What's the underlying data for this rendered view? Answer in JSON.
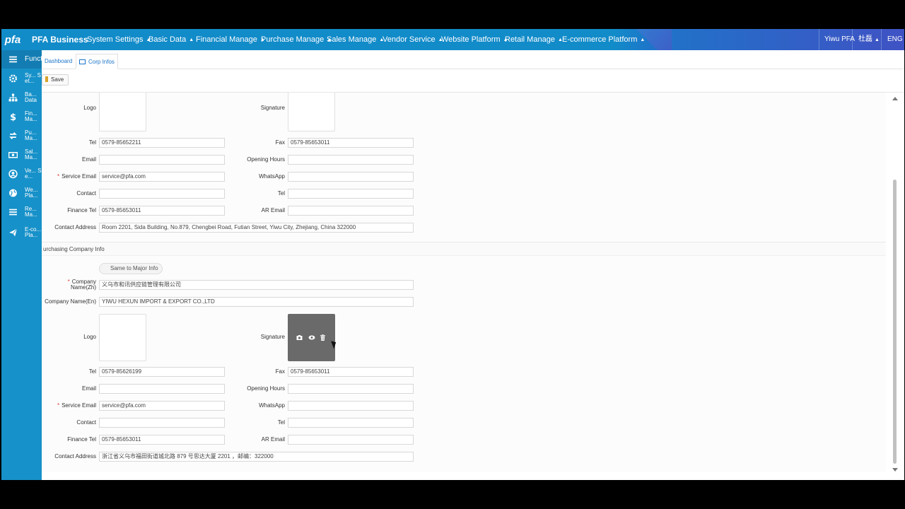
{
  "topbar": {
    "logo": "pfa",
    "brand": "PFA Business",
    "nav": [
      "System Settings",
      "Basic Data",
      "Financial Manage",
      "Purchase Manage",
      "Sales Manage",
      "Vendor Service",
      "Website Platform",
      "Retail Manage",
      "E-commerce Platform"
    ],
    "user": "Yiwu PFA",
    "lang_cn": "杜磊",
    "lang": "ENG"
  },
  "sidebar": {
    "header": "Functi",
    "items": [
      {
        "label": "Sy... Set...",
        "icon": "gear-icon"
      },
      {
        "label": "Ba... Data",
        "icon": "sitemap-icon"
      },
      {
        "label": "Fin... Ma...",
        "icon": "dollar-icon"
      },
      {
        "label": "Pu... Ma...",
        "icon": "exchange-icon"
      },
      {
        "label": "Sal... Ma...",
        "icon": "money-icon"
      },
      {
        "label": "Ve... Se...",
        "icon": "user-circle-icon"
      },
      {
        "label": "We... Pla...",
        "icon": "globe-icon"
      },
      {
        "label": "Re... Ma...",
        "icon": "list-icon"
      },
      {
        "label": "E-co... Pla...",
        "icon": "send-icon"
      }
    ]
  },
  "tabs": {
    "dashboard": "Dashboard",
    "corp": "Corp Infos"
  },
  "toolbar": {
    "save": "Save"
  },
  "major": {
    "logo": "Logo",
    "signature": "Signature",
    "tel_label": "Tel",
    "tel": "0579-85652211",
    "fax_label": "Fax",
    "fax": "0579-85653011",
    "email_label": "Email",
    "email": "",
    "hours_label": "Opening Hours",
    "hours": "",
    "service_email_label": "Service Email",
    "service_email": "service@pfa.com",
    "whatsapp_label": "WhatsApp",
    "whatsapp": "",
    "contact_label": "Contact",
    "contact": "",
    "tel2_label": "Tel",
    "tel2": "",
    "finance_tel_label": "Finance Tel",
    "finance_tel": "0579-85653011",
    "ar_email_label": "AR Email",
    "ar_email": "",
    "address_label": "Contact Address",
    "address": "Room 2201, Sida Building, No.879, Chengbei Road, Futian Street, Yiwu City, Zhejiang, China 322000"
  },
  "purchasing": {
    "section_title": "urchasing Company Info",
    "same_btn": "Same to Major Info",
    "name_zh_label": "Company Name(Zh)",
    "name_zh": "义乌市和讯供应链管理有限公司",
    "name_en_label": "Company Name(En)",
    "name_en": "YIWU HEXUN IMPORT & EXPORT CO.,LTD",
    "logo": "Logo",
    "signature": "Signature",
    "tel_label": "Tel",
    "tel": "0579-85626199",
    "fax_label": "Fax",
    "fax": "0579-85653011",
    "email_label": "Email",
    "email": "",
    "hours_label": "Opening Hours",
    "hours": "",
    "service_email_label": "Service Email",
    "service_email": "service@pfa.com",
    "whatsapp_label": "WhatsApp",
    "whatsapp": "",
    "contact_label": "Contact",
    "contact": "",
    "tel2_label": "Tel",
    "tel2": "",
    "finance_tel_label": "Finance Tel",
    "finance_tel": "0579-85653011",
    "ar_email_label": "AR Email",
    "ar_email": "",
    "address_label": "Contact Address",
    "address": "浙江省义乌市福田街道城北路 879 号思达大厦 2201 ，邮编：322000"
  },
  "colors": {
    "topbar": "#128bc9",
    "sidebar": "#1791c9",
    "required": "#e0403c",
    "link": "#1a73c9"
  }
}
